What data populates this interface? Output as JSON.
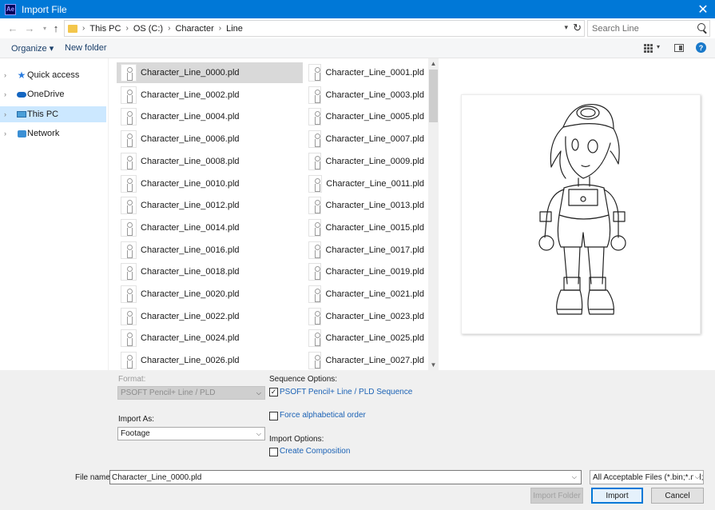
{
  "window": {
    "app_icon": "Ae",
    "title": "Import File",
    "close_glyph": "✕"
  },
  "address": {
    "crumbs": [
      "This PC",
      "OS (C:)",
      "Character",
      "Line"
    ],
    "search_placeholder": "Search Line"
  },
  "toolbar": {
    "organize_label": "Organize ▾",
    "new_folder_label": "New folder",
    "help_glyph": "?"
  },
  "nav": {
    "items": [
      {
        "label": "Quick access",
        "icon": "star-icon"
      },
      {
        "label": "OneDrive",
        "icon": "cloud-icon"
      },
      {
        "label": "This PC",
        "icon": "pc-icon",
        "selected": true
      },
      {
        "label": "Network",
        "icon": "network-icon"
      }
    ]
  },
  "files": [
    "Character_Line_0000.pld",
    "Character_Line_0001.pld",
    "Character_Line_0002.pld",
    "Character_Line_0003.pld",
    "Character_Line_0004.pld",
    "Character_Line_0005.pld",
    "Character_Line_0006.pld",
    "Character_Line_0007.pld",
    "Character_Line_0008.pld",
    "Character_Line_0009.pld",
    "Character_Line_0010.pld",
    "Character_Line_0011.pld",
    "Character_Line_0012.pld",
    "Character_Line_0013.pld",
    "Character_Line_0014.pld",
    "Character_Line_0015.pld",
    "Character_Line_0016.pld",
    "Character_Line_0017.pld",
    "Character_Line_0018.pld",
    "Character_Line_0019.pld",
    "Character_Line_0020.pld",
    "Character_Line_0021.pld",
    "Character_Line_0022.pld",
    "Character_Line_0023.pld",
    "Character_Line_0024.pld",
    "Character_Line_0025.pld",
    "Character_Line_0026.pld",
    "Character_Line_0027.pld"
  ],
  "selected_file_index": 0,
  "options": {
    "format_label": "Format:",
    "format_value": "PSOFT Pencil+ Line / PLD",
    "import_as_label": "Import As:",
    "import_as_value": "Footage",
    "sequence_options_label": "Sequence Options:",
    "sequence_checkbox_label": "PSOFT Pencil+ Line / PLD Sequence",
    "sequence_checked": true,
    "force_alpha_label": "Force alphabetical order",
    "force_alpha_checked": false,
    "import_options_label": "Import Options:",
    "create_comp_label": "Create Composition",
    "create_comp_checked": false
  },
  "footer": {
    "file_name_label": "File name:",
    "file_name_value": "Character_Line_0000.pld",
    "file_type_value": "All Acceptable Files (*.bin;*.mtl;*",
    "import_folder_label": "Import Folder",
    "import_label": "Import",
    "cancel_label": "Cancel"
  }
}
